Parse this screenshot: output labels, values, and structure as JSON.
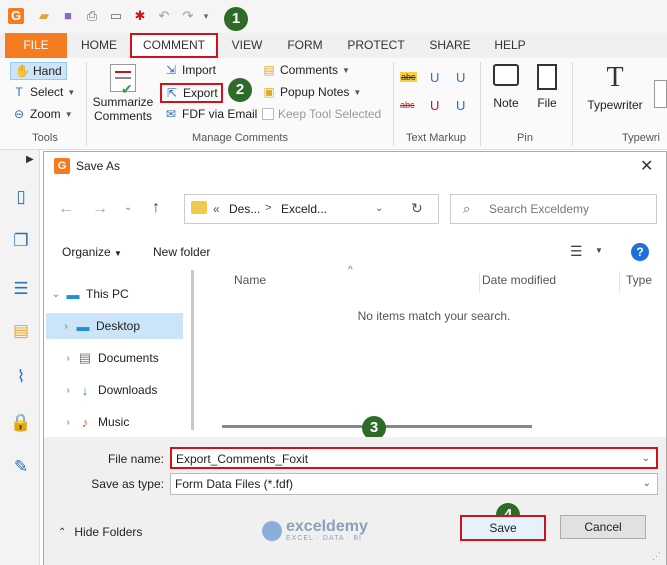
{
  "quick_access": {
    "icons": [
      "foxit-logo-icon",
      "open-folder-icon",
      "save-icon",
      "print-icon",
      "scan-icon",
      "new-icon",
      "undo-icon",
      "redo-icon",
      "customize-icon"
    ]
  },
  "steps": [
    "1",
    "2",
    "3",
    "4"
  ],
  "tabs": [
    "FILE",
    "HOME",
    "COMMENT",
    "VIEW",
    "FORM",
    "PROTECT",
    "SHARE",
    "HELP"
  ],
  "ribbon": {
    "tools": {
      "hand": "Hand",
      "select": "Select",
      "zoom": "Zoom",
      "label": "Tools"
    },
    "manage": {
      "summarize_line1": "Summarize",
      "summarize_line2": "Comments",
      "import": "Import",
      "export": "Export",
      "fdf_email": "FDF via Email",
      "comments": "Comments",
      "popup_notes": "Popup Notes",
      "keep_tool": "Keep Tool Selected",
      "label": "Manage Comments"
    },
    "text_markup": {
      "label": "Text Markup",
      "glyphs": [
        "abc",
        "U",
        "U",
        "abc",
        "U",
        "U"
      ]
    },
    "pin": {
      "note": "Note",
      "file": "File",
      "label": "Pin"
    },
    "typewriter": {
      "typewriter": "Typewriter",
      "label": "Typewri"
    }
  },
  "dialog": {
    "title": "Save As",
    "address": {
      "prefix": "«",
      "part1": "Des...",
      "sep": ">",
      "part2": "Exceld..."
    },
    "search_placeholder": "Search Exceldemy",
    "organize": "Organize",
    "new_folder": "New folder",
    "nav": [
      {
        "label": "This PC",
        "icon": "pc-icon",
        "expanded": true
      },
      {
        "label": "Desktop",
        "icon": "desktop-icon",
        "selected": true
      },
      {
        "label": "Documents",
        "icon": "documents-icon"
      },
      {
        "label": "Downloads",
        "icon": "downloads-icon"
      },
      {
        "label": "Music",
        "icon": "music-icon"
      }
    ],
    "columns": {
      "name": "Name",
      "date": "Date modified",
      "type": "Type"
    },
    "empty_message": "No items match your search.",
    "file_name_label": "File name:",
    "file_name_value": "Export_Comments_Foxit",
    "save_type_label": "Save as type:",
    "save_type_value": "Form Data Files (*.fdf)",
    "hide_folders": "Hide Folders",
    "save": "Save",
    "cancel": "Cancel",
    "watermark": {
      "name": "exceldemy",
      "tagline": "EXCEL · DATA · BI"
    }
  },
  "colors": {
    "accent_orange": "#f47b20",
    "highlight_red": "#d0121b",
    "step_green": "#2f6b28",
    "selected_nav": "#cce4f7"
  }
}
